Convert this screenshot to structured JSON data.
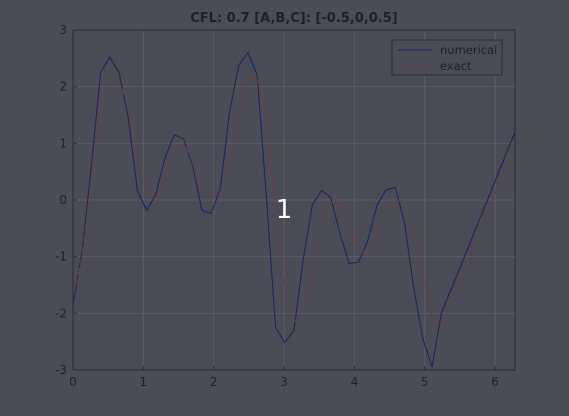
{
  "chart_data": {
    "type": "line",
    "title": "CFL: 0.7    [A,B,C]: [-0.5,0,0.5]",
    "xlabel": "",
    "ylabel": "",
    "xlim": [
      0,
      6.2832
    ],
    "ylim": [
      -3,
      3
    ],
    "xticks": [
      "0",
      "1",
      "2",
      "3",
      "4",
      "5",
      "6"
    ],
    "yticks": [
      "3",
      "2",
      "1",
      "0",
      "-1",
      "-2",
      "-3"
    ],
    "grid": true,
    "legend_position": "top-right",
    "overlay_label": "1",
    "colors": {
      "background": "#4b4d55",
      "axes_face": "#4a4c55",
      "grid": "#5a5d66",
      "axes": "#2a2c33",
      "text": "#1f2025",
      "numerical": "#1f2163",
      "exact": "#7a3b36",
      "overlay": "#ffffff"
    },
    "series": [
      {
        "name": "numerical",
        "style": "solid",
        "x": [
          0,
          0.1309,
          0.2618,
          0.3927,
          0.5236,
          0.6545,
          0.7854,
          0.9163,
          1.0472,
          1.1781,
          1.309,
          1.4399,
          1.5708,
          1.7017,
          1.8326,
          1.9635,
          2.0944,
          2.2253,
          2.3562,
          2.4871,
          2.618,
          2.7489,
          2.8798,
          3.0107,
          3.1416,
          3.2725,
          3.4034,
          3.5343,
          3.6652,
          3.7961,
          3.927,
          4.0579,
          4.1888,
          4.3197,
          4.4506,
          4.5815,
          4.7124,
          4.8433,
          4.9742,
          5.1051,
          5.236,
          5.3669,
          5.4978,
          5.6287,
          5.7596,
          5.8905,
          6.0214,
          6.1523,
          6.2832
        ],
        "y": [
          -1.85,
          -0.9,
          0.6,
          2.25,
          2.52,
          2.25,
          1.45,
          0.15,
          -0.18,
          0.1,
          0.75,
          1.15,
          1.08,
          0.6,
          -0.18,
          -0.24,
          0.2,
          1.55,
          2.38,
          2.6,
          2.2,
          0.05,
          -2.25,
          -2.52,
          -2.3,
          -1.05,
          -0.08,
          0.17,
          0.04,
          -0.6,
          -1.12,
          -1.1,
          -0.72,
          -0.1,
          0.18,
          0.22,
          -0.4,
          -1.55,
          -2.45,
          -2.95,
          -2.0,
          -1.6,
          -1.2,
          -0.8,
          -0.4,
          0,
          0.4,
          0.8,
          1.2
        ]
      },
      {
        "name": "exact",
        "style": "dashed",
        "x": [
          0,
          0.1309,
          0.2618,
          0.3927,
          0.5236,
          0.6545,
          0.7854,
          0.9163,
          1.0472,
          1.1781,
          1.309,
          1.4399,
          1.5708,
          1.7017,
          1.8326,
          1.9635,
          2.0944,
          2.2253,
          2.3562,
          2.4871,
          2.618,
          2.7489,
          2.8798,
          3.0107,
          3.1416,
          3.2725,
          3.4034,
          3.5343,
          3.6652,
          3.7961,
          3.927,
          4.0579,
          4.1888,
          4.3197,
          4.4506,
          4.5815,
          4.7124,
          4.8433,
          4.9742,
          5.1051,
          5.236,
          5.3669,
          5.4978,
          5.6287,
          5.7596,
          5.8905,
          6.0214,
          6.1523,
          6.2832
        ],
        "y": [
          -1.7,
          -1.0,
          0.4,
          1.75,
          2.18,
          2.1,
          1.65,
          0.7,
          0.12,
          0.0,
          0.4,
          0.85,
          1.0,
          0.7,
          0.2,
          0.05,
          0.1,
          0.6,
          1.5,
          2.15,
          2.15,
          1.6,
          -0.2,
          -1.55,
          -2.15,
          -2.05,
          -1.3,
          -0.45,
          -0.05,
          0.0,
          -0.45,
          -0.9,
          -0.95,
          -0.6,
          -0.18,
          0.0,
          -0.05,
          -0.55,
          -1.35,
          -2.05,
          -2.25,
          -1.85,
          -1.4,
          -1.0,
          -0.6,
          -0.2,
          0.2,
          0.6,
          1.0
        ]
      }
    ]
  }
}
